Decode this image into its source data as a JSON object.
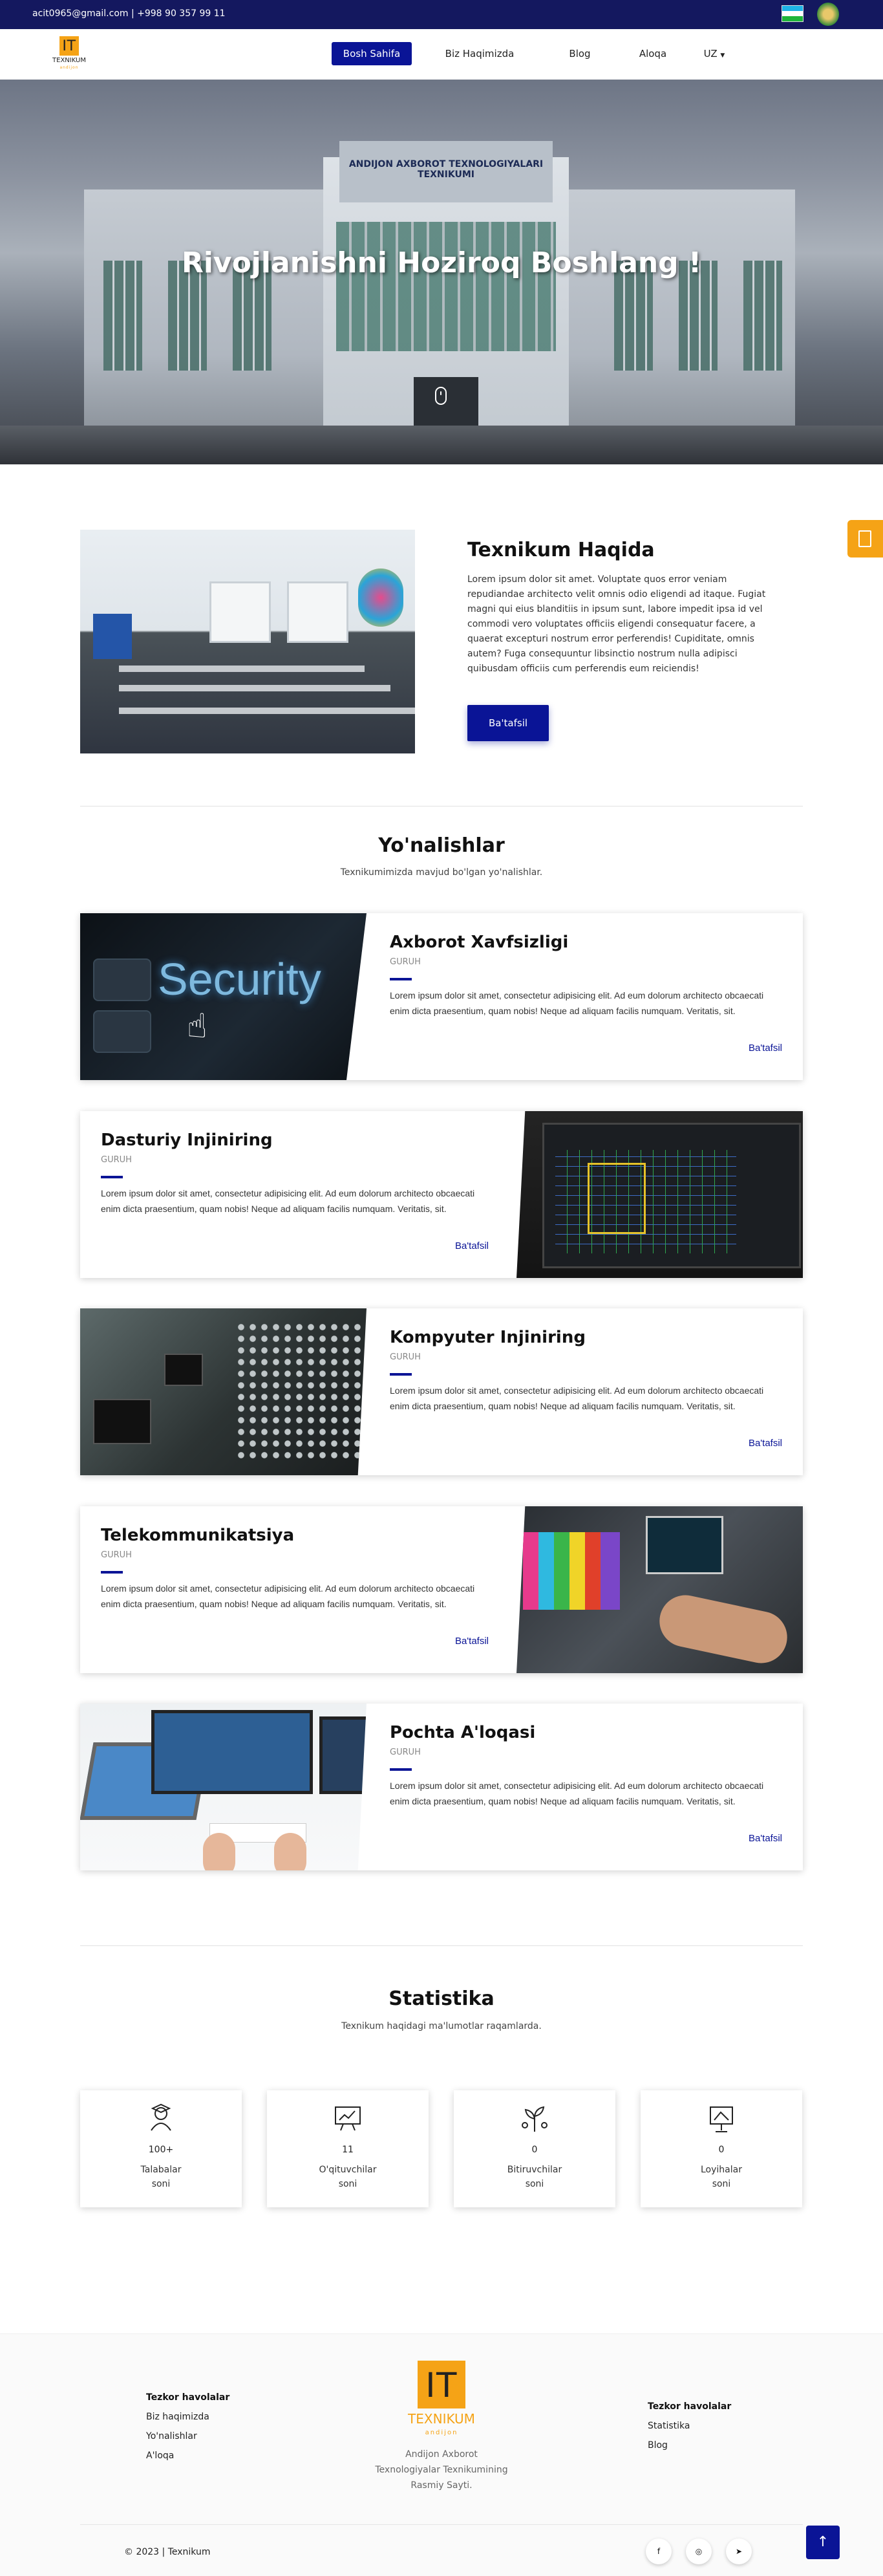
{
  "topbar": {
    "contact": "acit0965@gmail.com | +998 90 357 99 11",
    "flag_icon": "uzbekistan-flag-icon",
    "emblem_icon": "state-emblem-icon"
  },
  "nav": {
    "logo_text": "IT",
    "logo_word": "TEXNIKUM",
    "logo_sub": "andijon",
    "items": [
      "Bosh Sahifa",
      "Biz Haqimizda",
      "Blog",
      "Aloqa"
    ],
    "language": "UZ",
    "language_icon": "caret-down-icon"
  },
  "hero": {
    "sign_text": "ANDIJON AXBOROT TEXNOLOGIYALARI TEXNIKUMI",
    "title": "Rivojlanishni Hoziroq Boshlang !",
    "scroll_icon": "mouse-scroll-icon"
  },
  "side_tab": {
    "icon": "document-icon"
  },
  "about": {
    "heading": "Texnikum Haqida",
    "text": "Lorem ipsum dolor sit amet. Voluptate quos error veniam repudiandae architecto velit omnis odio eligendi ad itaque. Fugiat magni qui eius blanditiis in ipsum sunt, labore impedit ipsa id vel commodi vero voluptates officiis eligendi consequatur facere, a quaerat excepturi nostrum error perferendis! Cupiditate, omnis autem? Fuga consequuntur libsinctio nostrum nulla adipisci quibusdam officiis cum perferendis eum reiciendis!",
    "button": "Ba'tafsil"
  },
  "directions": {
    "heading": "Yo'nalishlar",
    "subtitle": "Texnikumimizda mavjud bo'lgan yo'nalishlar.",
    "image_text": "Security",
    "items": [
      {
        "title": "Axborot Xavfsizligi",
        "group": "GURUH",
        "text": "Lorem ipsum dolor sit amet, consectetur adipisicing elit. Ad eum dolorum architecto obcaecati enim dicta praesentium, quam nobis! Neque ad aliquam facilis numquam. Veritatis, sit.",
        "more": "Ba'tafsil"
      },
      {
        "title": "Dasturiy Injiniring",
        "group": "GURUH",
        "text": "Lorem ipsum dolor sit amet, consectetur adipisicing elit. Ad eum dolorum architecto obcaecati enim dicta praesentium, quam nobis! Neque ad aliquam facilis numquam. Veritatis, sit.",
        "more": "Ba'tafsil"
      },
      {
        "title": "Kompyuter Injiniring",
        "group": "GURUH",
        "text": "Lorem ipsum dolor sit amet, consectetur adipisicing elit. Ad eum dolorum architecto obcaecati enim dicta praesentium, quam nobis! Neque ad aliquam facilis numquam. Veritatis, sit.",
        "more": "Ba'tafsil"
      },
      {
        "title": "Telekommunikatsiya",
        "group": "GURUH",
        "text": "Lorem ipsum dolor sit amet, consectetur adipisicing elit. Ad eum dolorum architecto obcaecati enim dicta praesentium, quam nobis! Neque ad aliquam facilis numquam. Veritatis, sit.",
        "more": "Ba'tafsil"
      },
      {
        "title": "Pochta A'loqasi",
        "group": "GURUH",
        "text": "Lorem ipsum dolor sit amet, consectetur adipisicing elit. Ad eum dolorum architecto obcaecati enim dicta praesentium, quam nobis! Neque ad aliquam facilis numquam. Veritatis, sit.",
        "more": "Ba'tafsil"
      }
    ]
  },
  "stats": {
    "heading": "Statistika",
    "subtitle": "Texnikum haqidagi ma'lumotlar raqamlarda.",
    "items": [
      {
        "value": "100+",
        "label_1": "Talabalar",
        "label_2": "soni",
        "icon": "student-icon"
      },
      {
        "value": "11",
        "label_1": "O'qituvchilar",
        "label_2": "soni",
        "icon": "teacher-board-icon"
      },
      {
        "value": "0",
        "label_1": "Bitiruvchilar",
        "label_2": "soni",
        "icon": "graduate-plant-icon"
      },
      {
        "value": "0",
        "label_1": "Loyihalar",
        "label_2": "soni",
        "icon": "project-easel-icon"
      }
    ]
  },
  "footer": {
    "col1_heading": "Tezkor havolalar",
    "col1_links": [
      "Biz haqimizda",
      "Yo'nalishlar",
      "A'loqa"
    ],
    "logo_text": "IT",
    "logo_word": "TEXNIKUM",
    "logo_sub": "andijon",
    "desc_1": "Andijon Axborot",
    "desc_2": "Texnologiyalar Texnikumining",
    "desc_3": "Rasmiy Sayti.",
    "col2_heading": "Tezkor havolalar",
    "col2_links": [
      "Statistika",
      "Blog"
    ],
    "copyright": "© 2023  | Texnikum",
    "social": [
      {
        "icon": "facebook-icon",
        "glyph": "f"
      },
      {
        "icon": "instagram-icon",
        "glyph": "◎"
      },
      {
        "icon": "telegram-icon",
        "glyph": "➤"
      }
    ],
    "back_to_top_glyph": "↑"
  },
  "colors": {
    "primary": "#0a1496",
    "topbar": "#14185f",
    "accent": "#f5a316"
  }
}
